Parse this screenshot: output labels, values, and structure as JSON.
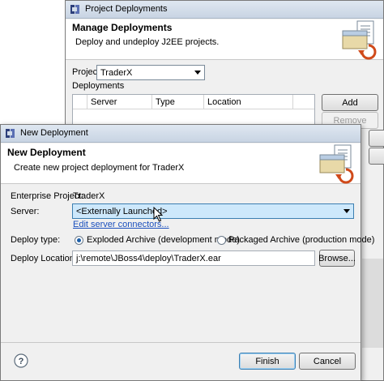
{
  "back_window": {
    "title": "Project Deployments",
    "header_title": "Manage Deployments",
    "header_desc": "Deploy and undeploy J2EE projects.",
    "project_label": "Project",
    "project_value": "TraderX",
    "deployments_label": "Deployments",
    "columns": [
      "Server",
      "Type",
      "Location"
    ],
    "add_label": "Add",
    "remove_label": "Remove"
  },
  "dialog": {
    "title": "New Deployment",
    "header_title": "New Deployment",
    "header_desc": "Create new project deployment for TraderX",
    "enterprise_project_label": "Enterprise Project:",
    "enterprise_project_value": "TraderX",
    "server_label": "Server:",
    "server_value": "<Externally Launched>",
    "edit_link": "Edit server connectors...",
    "deploy_type_label": "Deploy type:",
    "option_exploded": "Exploded Archive (development mode)",
    "option_packaged": "Packaged Archive (production mode)",
    "selected_option": "exploded",
    "deploy_location_label": "Deploy Location:",
    "deploy_location_value": "j:\\remote\\JBoss4\\deploy\\TraderX.ear",
    "browse_label": "Browse...",
    "finish_label": "Finish",
    "cancel_label": "Cancel",
    "help_icon": "question-mark"
  },
  "colors": {
    "titlebar": "#c8d4e3",
    "dialog_bg": "#f0f0f0",
    "selected_combo": "#cde8fb",
    "link": "#1a4fbd"
  }
}
